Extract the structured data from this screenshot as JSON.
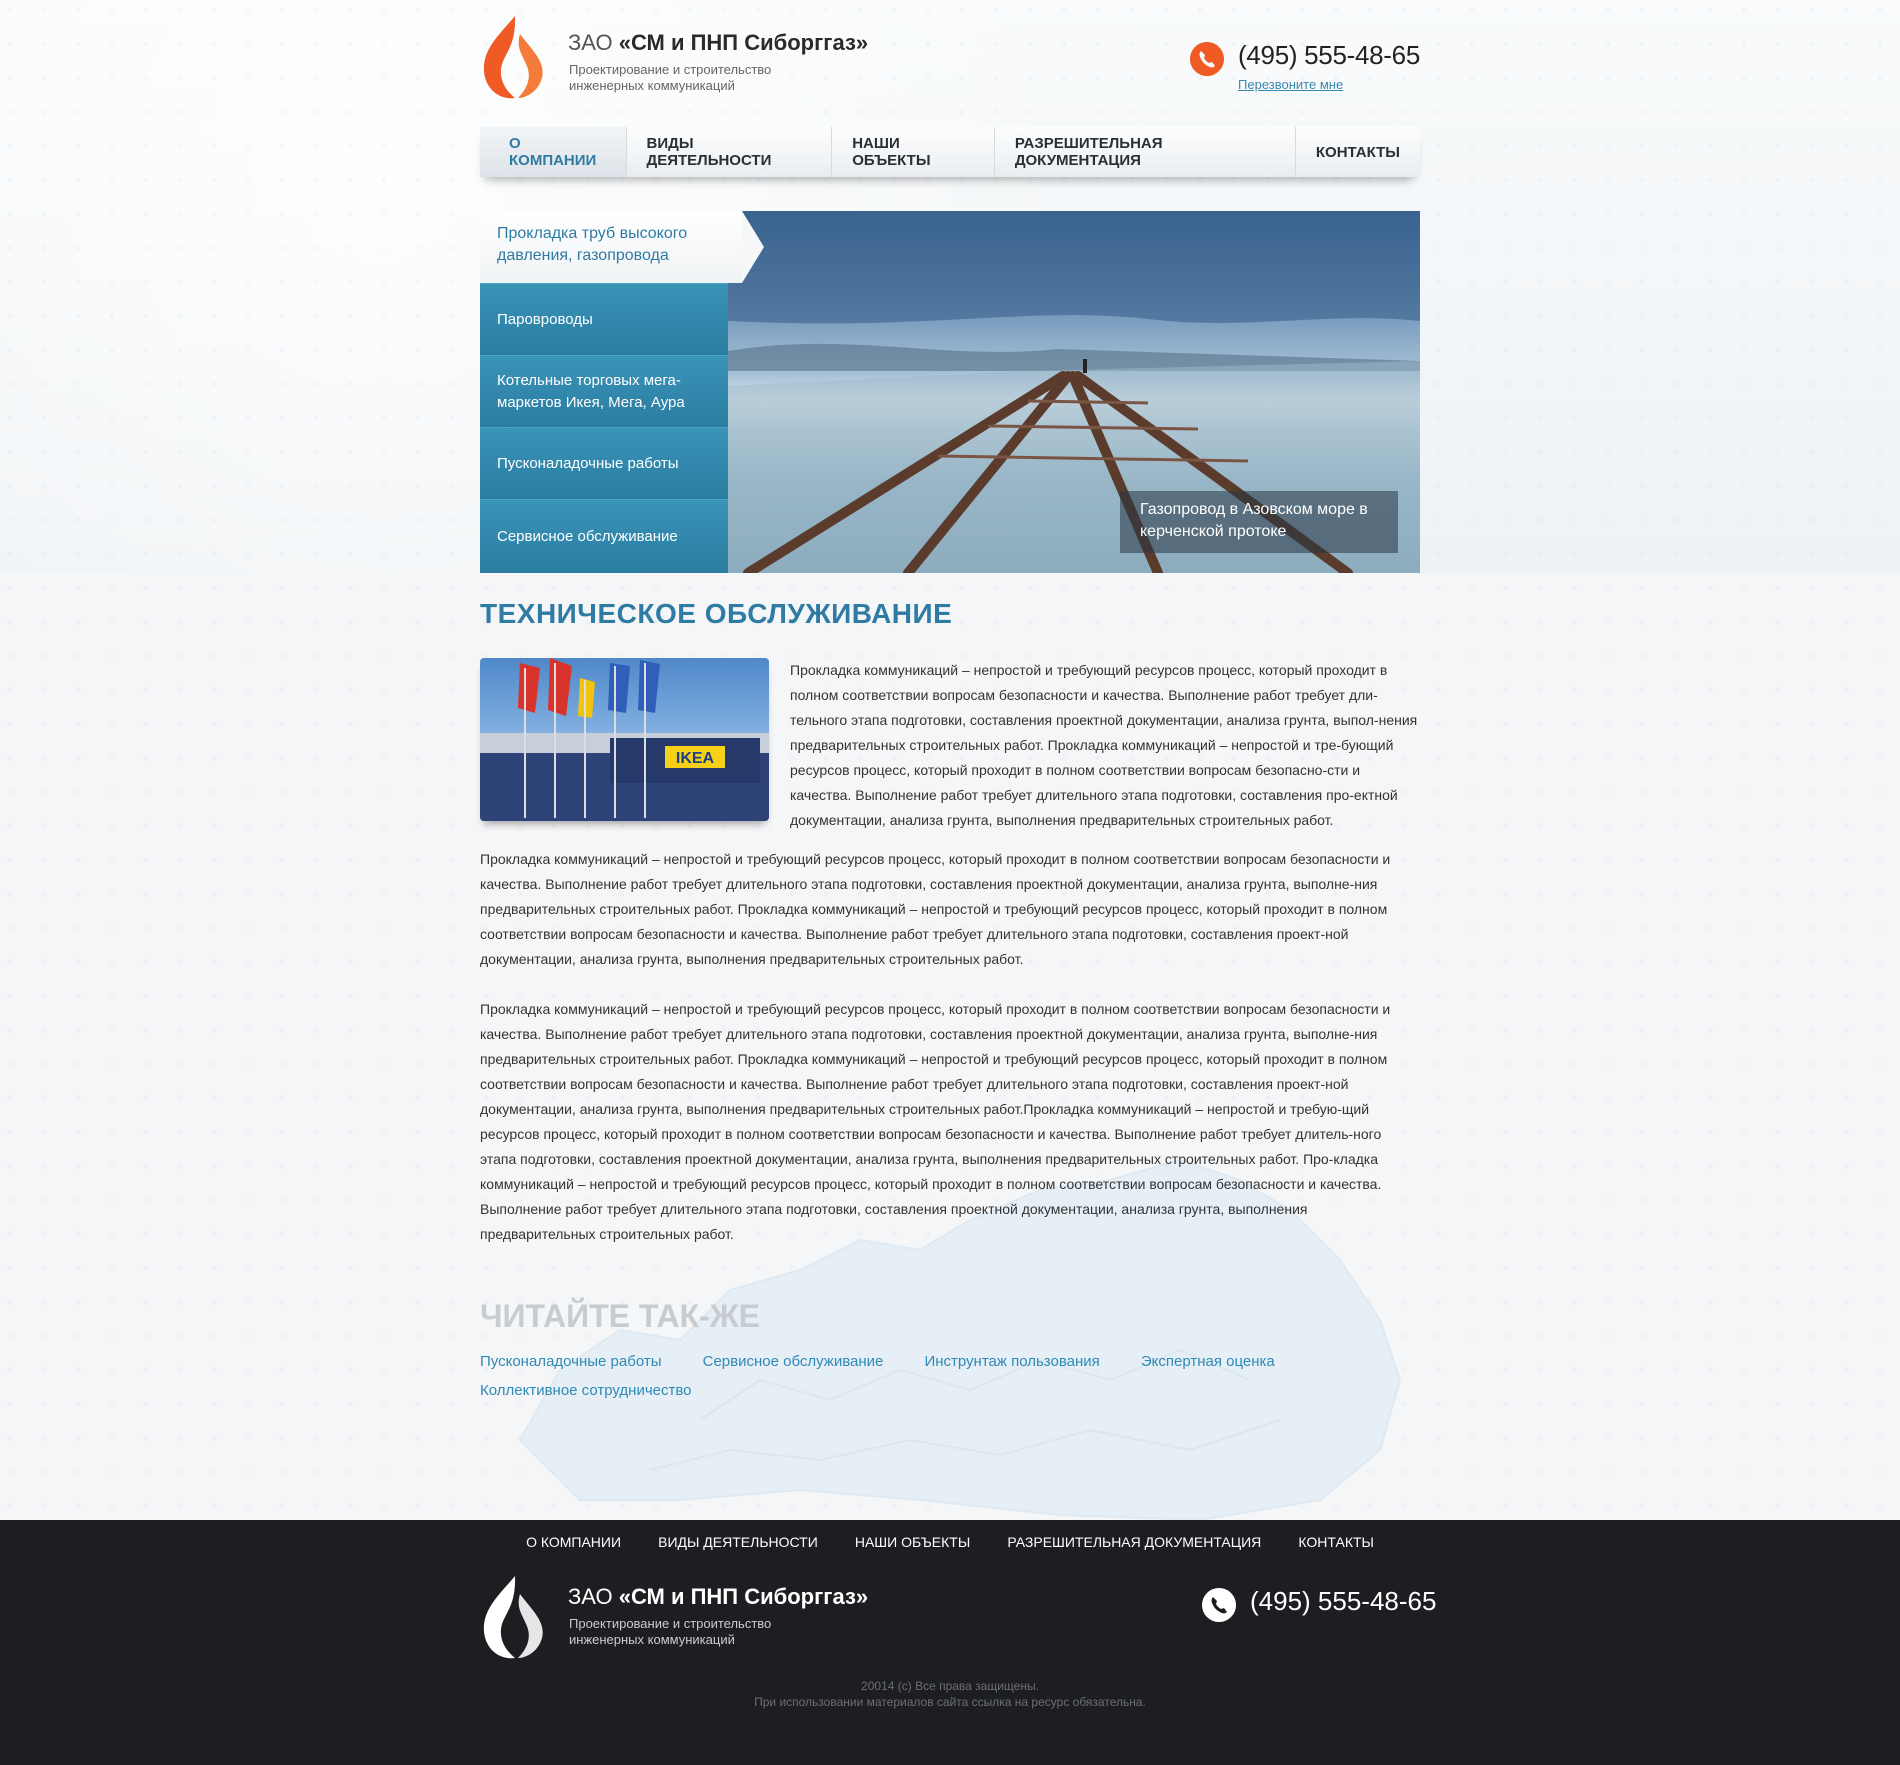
{
  "header": {
    "company_prefix": "ЗАО ",
    "company_name": "«СМ и ПНП Сиборггаз»",
    "tagline": "Проектирование и строительство инженерных коммуникаций",
    "phone": "(495) 555-48-65",
    "callback": "Перезвоните мне"
  },
  "nav": {
    "items": [
      {
        "label": "О КОМПАНИИ"
      },
      {
        "label": "ВИДЫ ДЕЯТЕЛЬНОСТИ"
      },
      {
        "label": "НАШИ ОБЪЕКТЫ"
      },
      {
        "label": "РАЗРЕШИТЕЛЬНАЯ ДОКУМЕНТАЦИЯ"
      },
      {
        "label": "КОНТАКТЫ"
      }
    ]
  },
  "slider": {
    "active": "Прокладка труб высокого давления, газопровода",
    "items": [
      {
        "label": "Паровроводы"
      },
      {
        "label": "Котельные торговых мега-маркетов Икея, Мега, Аура"
      },
      {
        "label": "Пусконаладочные работы"
      },
      {
        "label": "Сервисное обслуживание"
      }
    ],
    "caption": "Газопровод в Азовском море в керченской протоке"
  },
  "content": {
    "title": "ТЕХНИЧЕСКОЕ ОБСЛУЖИВАНИЕ",
    "intro": "Прокладка коммуникаций – непростой и требующий ресурсов процесс, который проходит в полном соответствии вопросам безопасности и качества. Выполнение работ требует дли-тельного этапа подготовки, составления проектной документации, анализа грунта, выпол-нения предварительных строительных работ. Прокладка коммуникаций – непростой и тре-бующий ресурсов процесс, который проходит в полном соответствии вопросам безопасно-сти и качества. Выполнение работ требует длительного этапа подготовки, составления про-ектной документации, анализа грунта, выполнения предварительных строительных работ.",
    "para1": "Прокладка коммуникаций – непростой и требующий ресурсов процесс, который проходит в полном соответствии вопросам безопасности и качества. Выполнение работ требует длительного этапа подготовки, составления проектной документации, анализа грунта, выполне-ния предварительных строительных работ. Прокладка коммуникаций – непростой и требующий ресурсов процесс, который проходит в полном соответствии вопросам безопасности и качества. Выполнение работ требует длительного этапа подготовки, составления проект-ной документации, анализа грунта, выполнения предварительных строительных работ.",
    "para2": "Прокладка коммуникаций – непростой и требующий ресурсов процесс, который проходит в полном соответствии вопросам безопасности и качества. Выполнение работ требует длительного этапа подготовки, составления проектной документации, анализа грунта, выполне-ния предварительных строительных работ. Прокладка коммуникаций – непростой и требующий ресурсов процесс, который проходит в полном соответствии вопросам безопасности и качества. Выполнение работ требует длительного этапа подготовки, составления проект-ной документации, анализа грунта, выполнения предварительных строительных работ.Прокладка коммуникаций – непростой и требую-щий ресурсов процесс, который проходит в полном соответствии вопросам безопасности и качества. Выполнение работ требует длитель-ного этапа подготовки, составления проектной документации, анализа грунта, выполнения предварительных строительных работ. Про-кладка коммуникаций – непростой и требующий ресурсов процесс, который проходит в полном соответствии вопросам безопасности и качества. Выполнение работ требует длительного этапа подготовки, составления проектной документации, анализа грунта, выполнения предварительных строительных работ.",
    "ikea_sign": "IKEA"
  },
  "read_also": {
    "title": "ЧИТАЙТЕ ТАК-ЖЕ",
    "links": [
      {
        "label": "Пусконаладочные работы"
      },
      {
        "label": "Сервисное обслуживание"
      },
      {
        "label": "Инструнтаж пользования"
      },
      {
        "label": "Экспертная оценка"
      },
      {
        "label": "Коллективное сотрудничество"
      }
    ]
  },
  "footer": {
    "nav": [
      {
        "label": "О КОМПАНИИ"
      },
      {
        "label": "ВИДЫ ДЕЯТЕЛЬНОСТИ"
      },
      {
        "label": "НАШИ ОБЪЕКТЫ"
      },
      {
        "label": "РАЗРЕШИТЕЛЬНАЯ ДОКУМЕНТАЦИЯ"
      },
      {
        "label": "КОНТАКТЫ"
      }
    ],
    "company_prefix": "ЗАО ",
    "company_name": "«СМ и ПНП Сиборггаз»",
    "tagline": "Проектирование и строительство инженерных коммуникаций",
    "phone": "(495) 555-48-65",
    "copyright": "20014 (с) Все права защищены.",
    "notice": "При использовании материалов сайта ссылка на ресурс обязательна."
  },
  "colors": {
    "accent": "#2f7ba3",
    "brand_orange": "#f05a24",
    "menu_blue": "#3a94b8",
    "footer_bg": "#1d1e21"
  },
  "icons": [
    "flame-logo-icon",
    "phone-icon"
  ]
}
